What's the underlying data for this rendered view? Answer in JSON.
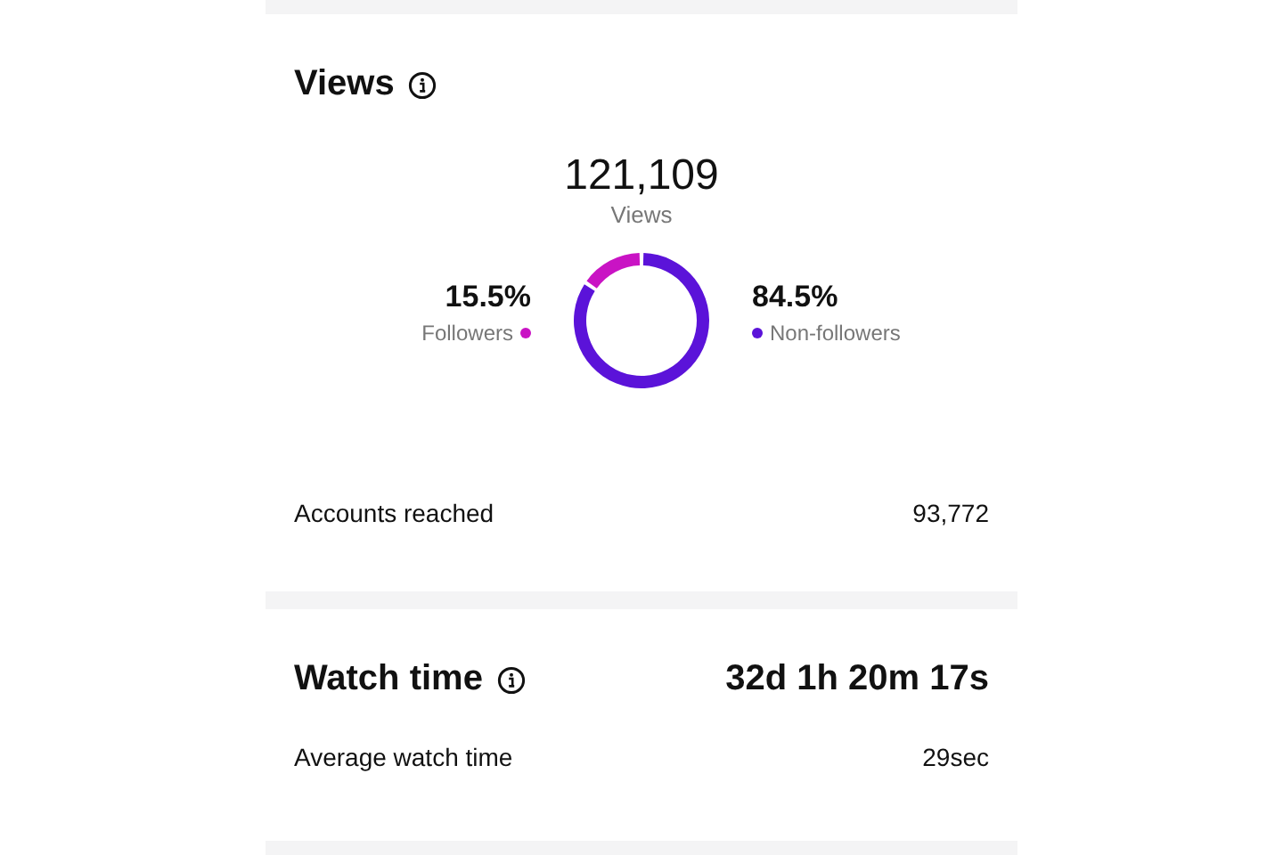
{
  "views": {
    "title": "Views",
    "total": "121,109",
    "chart_data": {
      "type": "donut",
      "categories": [
        "Followers",
        "Non-followers"
      ],
      "series": [
        {
          "name": "Views",
          "values": [
            15.5,
            84.5
          ]
        }
      ]
    },
    "segments": [
      {
        "percent": "15.5%",
        "color": "#c913c4"
      },
      {
        "percent": "84.5%",
        "color": "#5b13d9"
      }
    ],
    "rows": [
      {
        "label": "Accounts reached",
        "value": "93,772"
      }
    ]
  },
  "watch_time": {
    "title": "Watch time",
    "total": "32d 1h 20m 17s",
    "rows": [
      {
        "label": "Average watch time",
        "value": "29sec"
      }
    ]
  }
}
